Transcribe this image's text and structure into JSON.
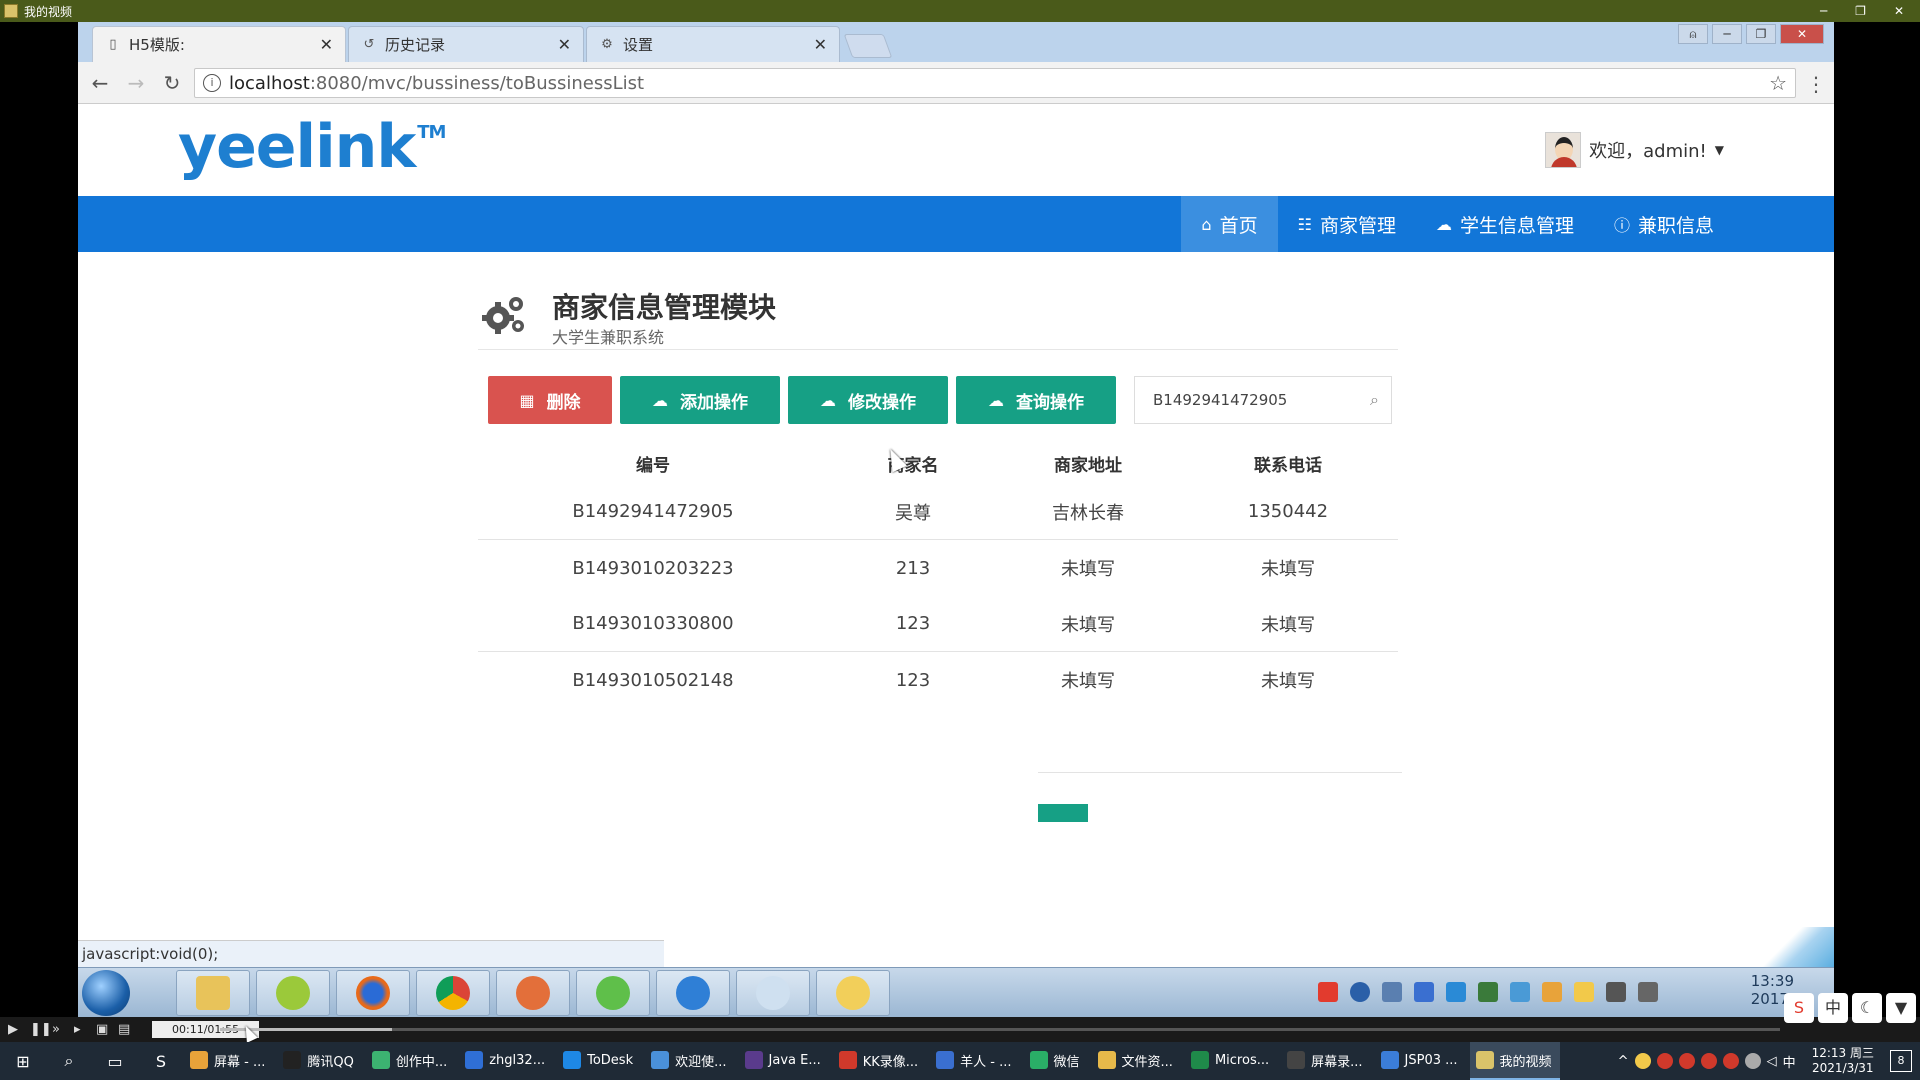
{
  "video_player": {
    "title": "我的视频",
    "time": "00:11/01:55",
    "progress": 0.11
  },
  "browser": {
    "tabs": [
      {
        "label": "H5模版:",
        "icon": "page-icon",
        "active": true
      },
      {
        "label": "历史记录",
        "icon": "history-icon",
        "active": false
      },
      {
        "label": "设置",
        "icon": "gear-icon",
        "active": false
      }
    ],
    "close_glyph": "✕",
    "url_host": "localhost",
    "url_rest": ":8080/mvc/bussiness/toBussinessList",
    "status_text": "javascript:void(0);"
  },
  "page": {
    "logo": "yeelink",
    "logo_tm": "TM",
    "user_greeting": "欢迎，admin!",
    "nav": [
      {
        "label": "首页",
        "icon": "home-icon",
        "active": true
      },
      {
        "label": "商家管理",
        "icon": "sitemap-icon",
        "active": false
      },
      {
        "label": "学生信息管理",
        "icon": "cloud-icon",
        "active": false
      },
      {
        "label": "兼职信息",
        "icon": "info-icon",
        "active": false
      }
    ],
    "title": "商家信息管理模块",
    "subtitle": "大学生兼职系统",
    "actions": {
      "delete": "删除",
      "add": "添加操作",
      "edit": "修改操作",
      "query": "查询操作"
    },
    "search_value": "B1492941472905",
    "table": {
      "headers": [
        "编号",
        "商家名",
        "商家地址",
        "联系电话"
      ],
      "rows": [
        [
          "B1492941472905",
          "吴尊",
          "吉林长春",
          "1350442"
        ],
        [
          "B1493010203223",
          "213",
          "未填写",
          "未填写"
        ],
        [
          "B1493010330800",
          "123",
          "未填写",
          "未填写"
        ],
        [
          "B1493010502148",
          "123",
          "未填写",
          "未填写"
        ]
      ]
    }
  },
  "inner_taskbar": {
    "clock_time": "13:39",
    "clock_date": "2017/"
  },
  "host_taskbar": {
    "apps": [
      {
        "label": "屏幕 - ...",
        "color": "#e8a33a"
      },
      {
        "label": "腾讯QQ",
        "color": "#222222"
      },
      {
        "label": "创作中...",
        "color": "#3cb371"
      },
      {
        "label": "zhgl32...",
        "color": "#2f6fd6"
      },
      {
        "label": "ToDesk",
        "color": "#1e88e5"
      },
      {
        "label": "欢迎使...",
        "color": "#4a90d9"
      },
      {
        "label": "Java E...",
        "color": "#5a3b8c"
      },
      {
        "label": "KK录像...",
        "color": "#d0392b"
      },
      {
        "label": "羊人 - ...",
        "color": "#3a6fd0"
      },
      {
        "label": "微信",
        "color": "#2aae67"
      },
      {
        "label": "文件资...",
        "color": "#e7b94a"
      },
      {
        "label": "Micros...",
        "color": "#1f8a4a"
      },
      {
        "label": "屏幕录...",
        "color": "#444444"
      },
      {
        "label": "JSP03 ...",
        "color": "#3b7dd8"
      },
      {
        "label": "我的视频",
        "color": "#d9c36a",
        "active": true
      }
    ],
    "clock_time": "12:13 周三",
    "clock_date": "2021/3/31",
    "ime": "中",
    "notify_count": "8"
  },
  "colors": {
    "nav_blue": "#1276d8",
    "danger": "#d9534f",
    "teal": "#16a085"
  }
}
